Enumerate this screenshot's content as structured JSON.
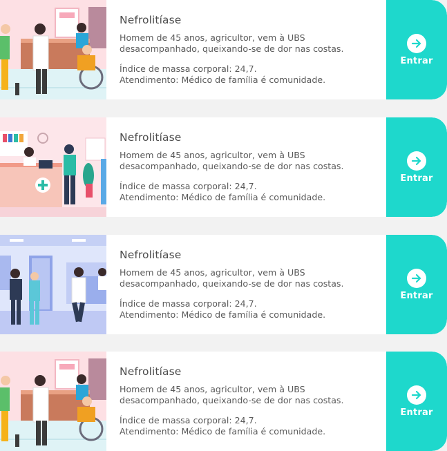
{
  "cards": [
    {
      "title": "Nefrolitíase",
      "line1": "Homem de 45 anos, agricultor, vem à UBS",
      "line2": "desacompanhado, queixando-se de dor nas costas.",
      "line3": "Índice de massa corporal: 24,7.",
      "line4": "Atendimento: Médico de família é comunidade.",
      "button": "Entrar",
      "illustration": "clinic-reception-wheelchair"
    },
    {
      "title": "Nefrolitíase",
      "line1": "Homem de 45 anos, agricultor, vem à UBS",
      "line2": "desacompanhado, queixando-se de dor nas costas.",
      "line3": "Índice de massa corporal: 24,7.",
      "line4": "Atendimento: Médico de família é comunidade.",
      "button": "Entrar",
      "illustration": "pharmacy-counter"
    },
    {
      "title": "Nefrolitíase",
      "line1": "Homem de 45 anos, agricultor, vem à UBS",
      "line2": "desacompanhado, queixando-se de dor nas costas.",
      "line3": "Índice de massa corporal: 24,7.",
      "line4": "Atendimento: Médico de família é comunidade.",
      "button": "Entrar",
      "illustration": "hospital-hallway"
    },
    {
      "title": "Nefrolitíase",
      "line1": "Homem de 45 anos, agricultor, vem à UBS",
      "line2": "desacompanhado, queixando-se de dor nas costas.",
      "line3": "Índice de massa corporal: 24,7.",
      "line4": "Atendimento: Médico de família é comunidade.",
      "button": "Entrar",
      "illustration": "clinic-reception-wheelchair"
    }
  ],
  "colors": {
    "accent": "#1ed8cc",
    "background": "#f2f2f2",
    "card": "#ffffff"
  },
  "icons": {
    "enter": "arrow-right-circle-icon"
  }
}
